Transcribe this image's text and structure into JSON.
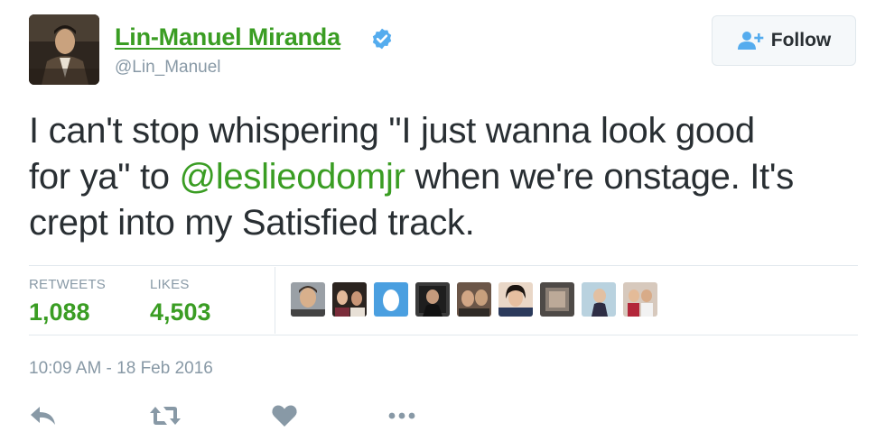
{
  "author": {
    "display_name": "Lin-Manuel Miranda",
    "handle": "@Lin_Manuel",
    "verified": true,
    "avatar_icon": "profile-photo"
  },
  "follow_button": {
    "label": "Follow",
    "icon": "follow-person-plus-icon"
  },
  "tweet": {
    "line1": "I can't stop whispering \"I just wanna look good",
    "line2_pre": "for ya\" to ",
    "mention": "@leslieodomjr",
    "line2_post": " when we're onstage. It's",
    "line3": "crept into my Satisfied track."
  },
  "stats": {
    "retweets_label": "RETWEETS",
    "retweets_value": "1,088",
    "likes_label": "LIKES",
    "likes_value": "4,503"
  },
  "likers": [
    {
      "name": "liker-avatar-1",
      "icon": "photo"
    },
    {
      "name": "liker-avatar-2",
      "icon": "photo"
    },
    {
      "name": "liker-avatar-3",
      "icon": "default-egg"
    },
    {
      "name": "liker-avatar-4",
      "icon": "photo"
    },
    {
      "name": "liker-avatar-5",
      "icon": "photo"
    },
    {
      "name": "liker-avatar-6",
      "icon": "photo"
    },
    {
      "name": "liker-avatar-7",
      "icon": "photo"
    },
    {
      "name": "liker-avatar-8",
      "icon": "photo"
    },
    {
      "name": "liker-avatar-9",
      "icon": "photo"
    }
  ],
  "timestamp": "10:09 AM - 18 Feb 2016",
  "actions": [
    {
      "name": "reply",
      "icon": "reply-icon"
    },
    {
      "name": "retweet",
      "icon": "retweet-icon"
    },
    {
      "name": "like",
      "icon": "heart-icon"
    },
    {
      "name": "more",
      "icon": "more-dots-icon"
    }
  ],
  "colors": {
    "accent_green": "#3a9d23",
    "verified_blue": "#55acee",
    "muted_gray": "#8899a6",
    "text": "#292f33",
    "divider": "#e1e8ed",
    "follow_icon_blue": "#55acee"
  }
}
